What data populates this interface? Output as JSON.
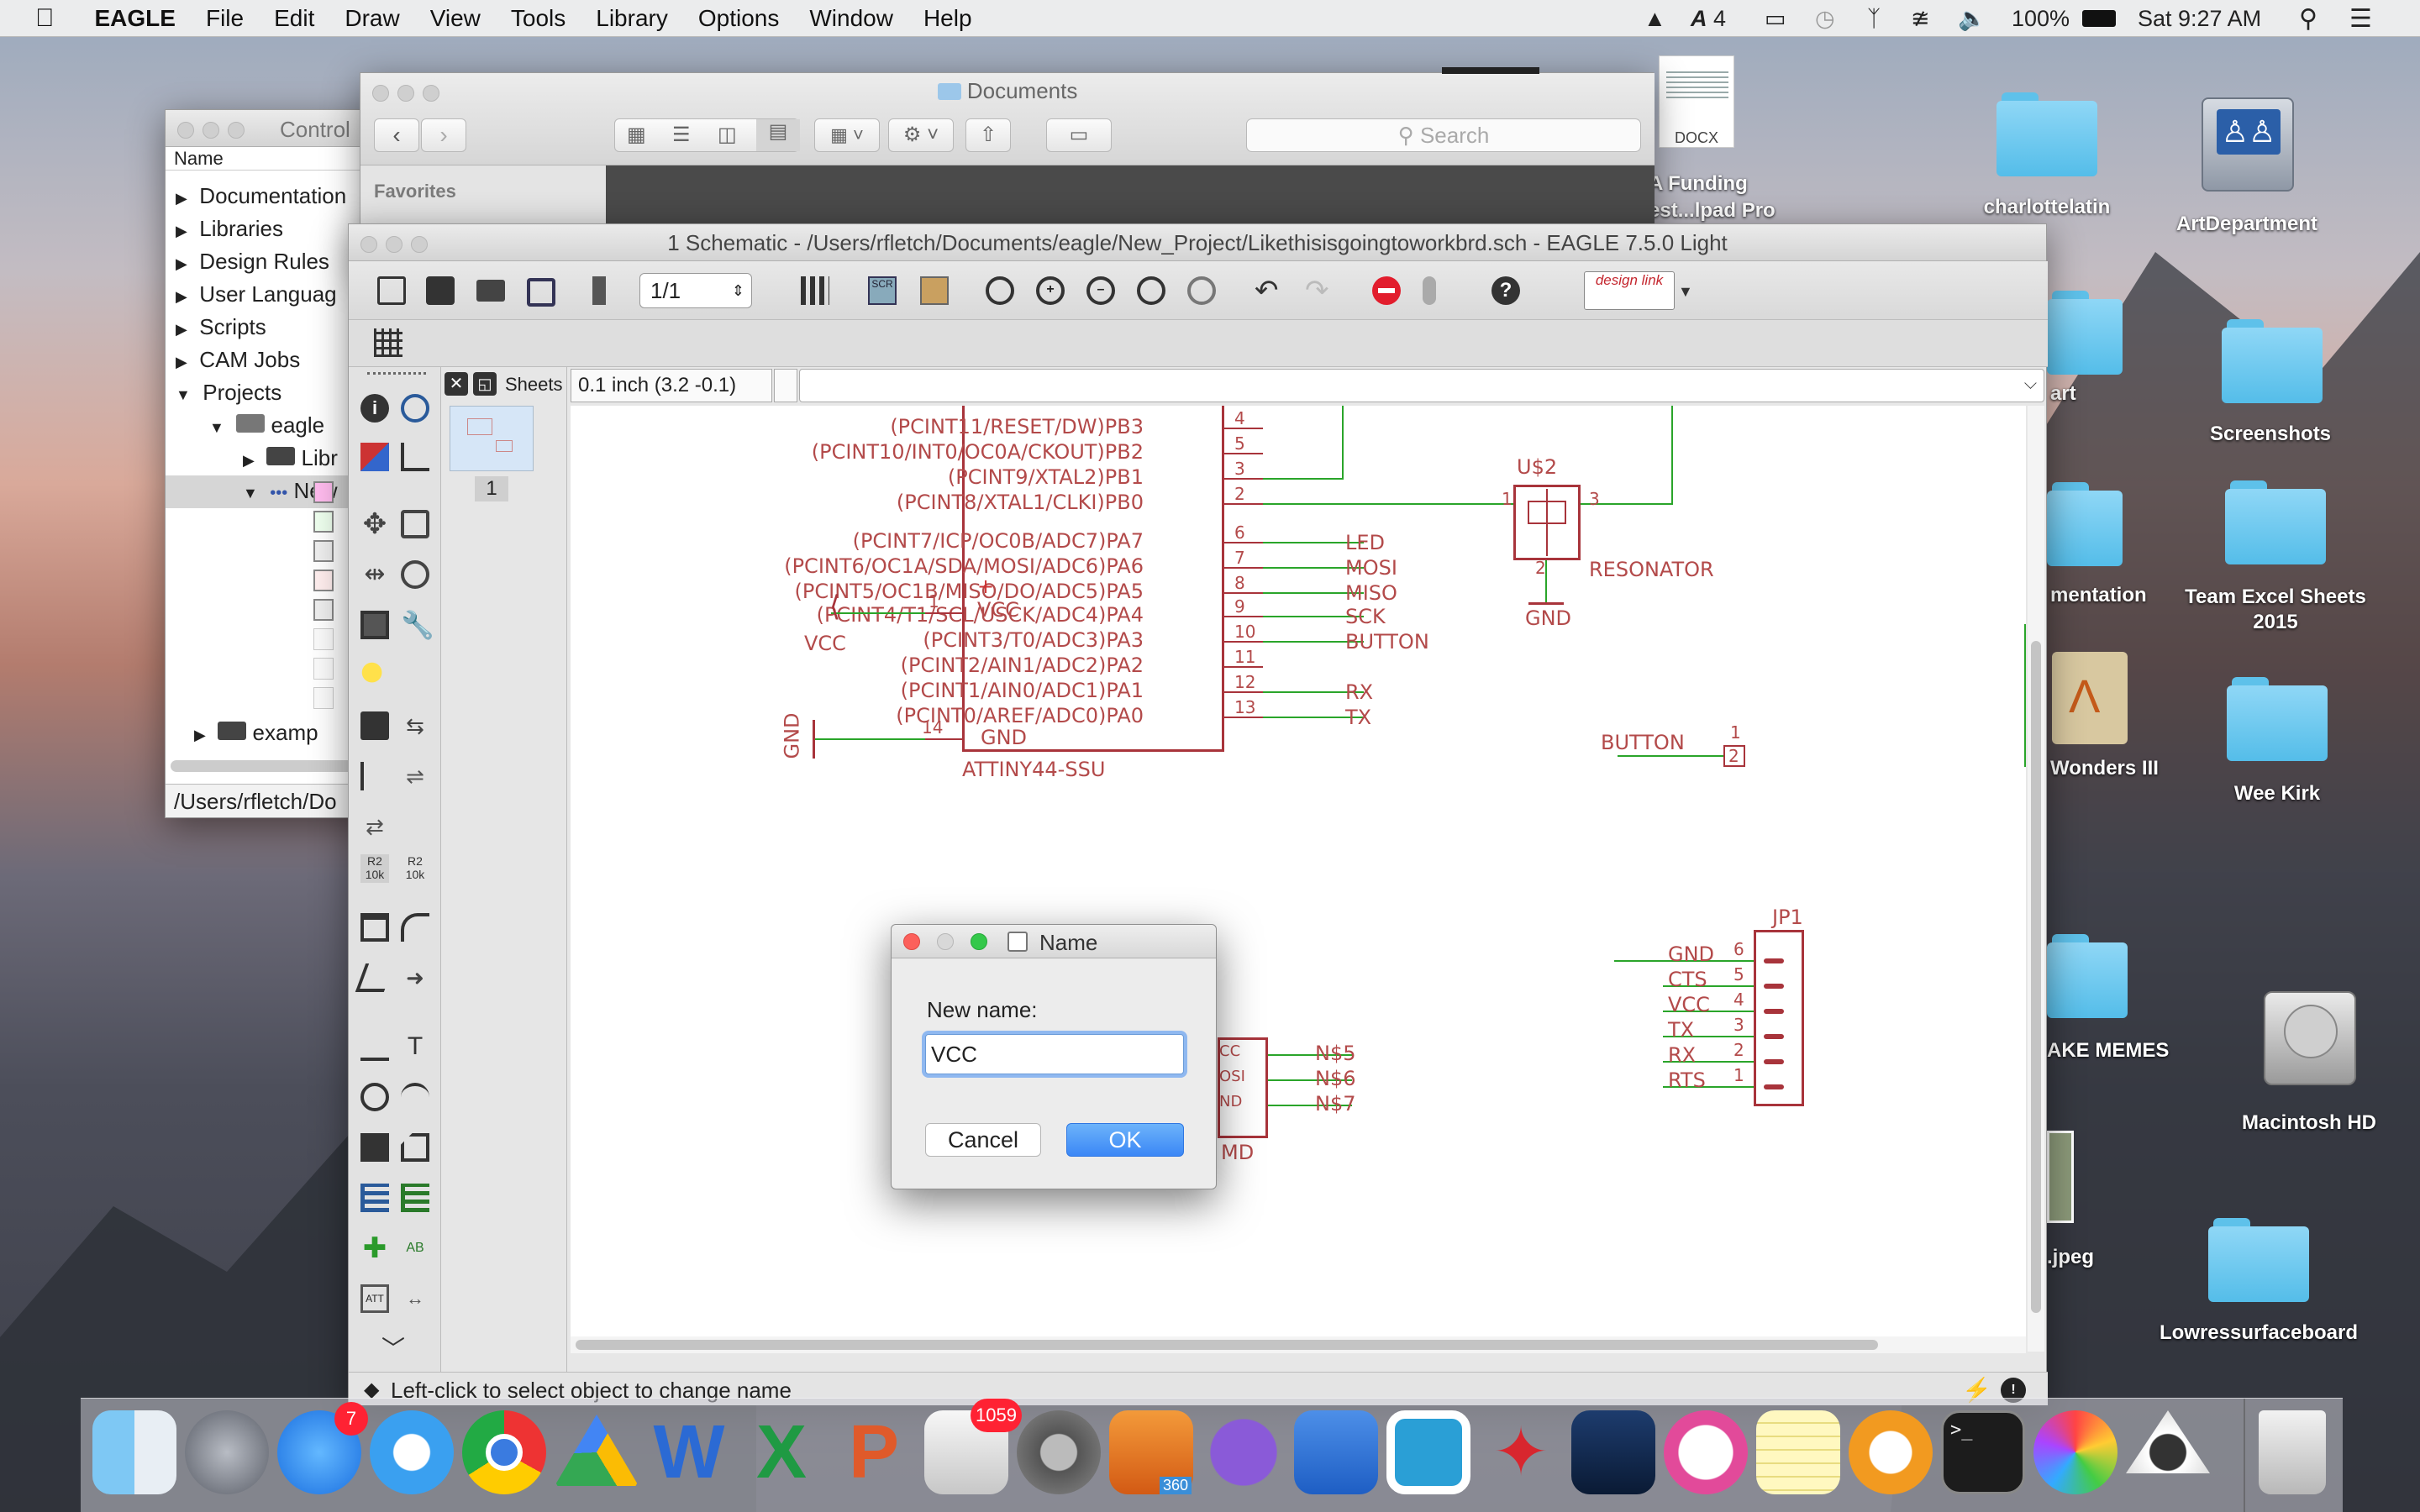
{
  "menubar": {
    "app": "EAGLE",
    "menus": [
      "File",
      "Edit",
      "Draw",
      "View",
      "Tools",
      "Library",
      "Options",
      "Window",
      "Help"
    ],
    "adobe_badge": "4",
    "battery": "100%",
    "clock": "Sat 9:27 AM"
  },
  "desktop": {
    "icons": [
      {
        "label": "charlottelatin",
        "icon": "folder-icon"
      },
      {
        "label": "ArtDepartment",
        "icon": "network-drive-icon"
      },
      {
        "label": "Screenshots",
        "icon": "folder-icon"
      },
      {
        "label": "Team Excel Sheets 2015",
        "icon": "folder-icon"
      },
      {
        "label": "Wee Kirk",
        "icon": "folder-icon"
      },
      {
        "label": "Macintosh HD",
        "icon": "hard-drive-icon"
      },
      {
        "label": "Lowressurfaceboard",
        "icon": "folder-icon"
      },
      {
        "label": "A Funding",
        "icon": "docx-icon"
      },
      {
        "label": "est...lpad Pro",
        "icon": "docx-icon"
      },
      {
        "label": "art",
        "icon": "folder-icon"
      },
      {
        "label": "mentation",
        "icon": "folder-icon"
      },
      {
        "label": "Wonders III",
        "icon": "app-icon"
      },
      {
        "label": "AKE MEMES",
        "icon": "folder-icon"
      },
      {
        "label": ".jpeg",
        "icon": "image-icon"
      }
    ],
    "docx_badge": "DOCX"
  },
  "control_panel": {
    "title": "Control",
    "column_header": "Name",
    "tree": [
      "Documentation",
      "Libraries",
      "Design Rules",
      "User Languag",
      "Scripts",
      "CAM Jobs",
      "Projects",
      "eagle",
      "Libr",
      "New",
      "examp"
    ],
    "path": "/Users/rfletch/Do"
  },
  "finder": {
    "title": "Documents",
    "search_placeholder": "Search",
    "sidebar_header": "Favorites"
  },
  "eagle": {
    "title": "1 Schematic - /Users/rfletch/Documents/eagle/New_Project/Likethisisgoingtoworkbrd.sch - EAGLE 7.5.0 Light",
    "sheet_select": "1/1",
    "coord_display": "0.1 inch (3.2 -0.1)",
    "command_line": "",
    "sheets_label": "Sheets",
    "sheet_number": "1",
    "design_link": "design link",
    "status_text": "Left-click to select object to change name",
    "schematic": {
      "chip_name": "ATTINY44-SSU",
      "chip_pins_right": [
        {
          "label": "(PCINT11/RESET/DW)PB3",
          "num": "4"
        },
        {
          "label": "(PCINT10/INT0/OC0A/CKOUT)PB2",
          "num": "5"
        },
        {
          "label": "(PCINT9/XTAL2)PB1",
          "num": "3"
        },
        {
          "label": "(PCINT8/XTAL1/CLKI)PB0",
          "num": "2"
        },
        {
          "label": "(PCINT7/ICP/OC0B/ADC7)PA7",
          "num": "6"
        },
        {
          "label": "(PCINT6/OC1A/SDA/MOSI/ADC6)PA6",
          "num": "7"
        },
        {
          "label": "(PCINT5/OC1B/MISO/DO/ADC5)PA5",
          "num": "8"
        },
        {
          "label": "(PCINT4/T1/SCL/USCK/ADC4)PA4",
          "num": "9"
        },
        {
          "label": "(PCINT3/T0/ADC3)PA3",
          "num": "10"
        },
        {
          "label": "(PCINT2/AIN1/ADC2)PA2",
          "num": "11"
        },
        {
          "label": "(PCINT1/AIN0/ADC1)PA1",
          "num": "12"
        },
        {
          "label": "(PCINT0/AREF/ADC0)PA0",
          "num": "13"
        }
      ],
      "net_labels": [
        "LED",
        "MOSI",
        "MISO",
        "SCK",
        "BUTTON",
        "RX",
        "TX"
      ],
      "vcc_pin": {
        "label": "VCC",
        "num": "1",
        "plus": "+"
      },
      "gnd_pin": {
        "label": "GND",
        "num": "14"
      },
      "vcc_symbol": "VCC",
      "gnd_symbol": "GND",
      "resonator": {
        "name": "U$2",
        "value": "RESONATOR",
        "pin1": "1",
        "pin2": "2",
        "pin3": "3",
        "gnd": "GND"
      },
      "button": {
        "label": "BUTTON",
        "pin1": "1",
        "pin2": "2"
      },
      "jp1": {
        "name": "JP1",
        "pins": [
          {
            "label": "GND",
            "num": "6"
          },
          {
            "label": "CTS",
            "num": "5"
          },
          {
            "label": "VCC",
            "num": "4"
          },
          {
            "label": "TX",
            "num": "3"
          },
          {
            "label": "RX",
            "num": "2"
          },
          {
            "label": "RTS",
            "num": "1"
          }
        ]
      },
      "nets": [
        "N$5",
        "N$6",
        "N$7"
      ],
      "partial_pins": [
        "CC",
        "OSI",
        "ND"
      ],
      "partial_label": "MD"
    }
  },
  "dialog": {
    "title": "Name",
    "prompt": "New name:",
    "value": "VCC",
    "cancel": "Cancel",
    "ok": "OK"
  },
  "dock": {
    "badges": {
      "app_store": "7",
      "mail": "1059",
      "fusion": "360"
    },
    "apps": [
      "finder-icon",
      "launchpad-icon",
      "app-store-icon",
      "safari-icon",
      "chrome-icon",
      "google-drive-icon",
      "word-icon",
      "excel-icon",
      "powerpoint-icon",
      "mail-icon",
      "system-preferences-icon",
      "fusion360-icon",
      "github-icon",
      "self-service-icon",
      "scrivener-icon",
      "eagle-icon",
      "xcode-icon",
      "itunes-icon",
      "notes-icon",
      "ibooks-icon",
      "terminal-icon",
      "photos-icon",
      "inkscape-icon",
      "trash-icon"
    ]
  },
  "colors": {
    "accent": "#3b87f6",
    "schematic_red": "#a8343b",
    "net_green": "#2aa52a",
    "folder_blue": "#5ec1ea"
  }
}
